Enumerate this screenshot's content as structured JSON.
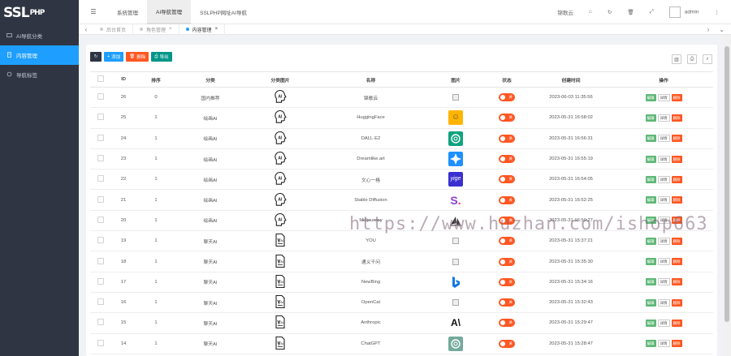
{
  "brand": {
    "logo_main": "SSL",
    "logo_sup": "PHP"
  },
  "sidebar": {
    "items": [
      {
        "label": "AI导航分类",
        "icon": "folder-icon",
        "active": false
      },
      {
        "label": "内容管理",
        "icon": "document-icon",
        "active": true
      },
      {
        "label": "导航标签",
        "icon": "tag-icon",
        "active": false
      }
    ]
  },
  "topbar": {
    "menu_icon": "☰",
    "nav": [
      {
        "label": "系统管理",
        "active": false
      },
      {
        "label": "AI导航管理",
        "active": true
      },
      {
        "label": "SSLPHP网址AI导航",
        "active": false
      }
    ],
    "link": "锦歌云",
    "user": "admin",
    "icons": [
      "home-icon",
      "refresh-icon",
      "trash-icon",
      "fullscreen-icon",
      "more-icon"
    ]
  },
  "tabs": [
    {
      "label": "后台首页",
      "active": false
    },
    {
      "label": "角色管理",
      "active": false
    },
    {
      "label": "内容管理",
      "active": true
    }
  ],
  "toolbar": {
    "add": "添加",
    "delete": "删除",
    "export": "导出"
  },
  "table": {
    "headers": [
      "ID",
      "排序",
      "分类",
      "分类图片",
      "名称",
      "图片",
      "状态",
      "创建时间",
      "操作"
    ],
    "toggle_label": "关",
    "ops": {
      "edit": "编辑",
      "detail": "详情",
      "delete": "删除"
    },
    "rows": [
      {
        "id": "26",
        "sort": "0",
        "category": "国内推荐",
        "cat_icon": "ai-head",
        "name": "锦歌云",
        "pic": "broken",
        "time": "2023-06-03 11:35:56"
      },
      {
        "id": "25",
        "sort": "1",
        "category": "绘画AI",
        "cat_icon": "ai-head",
        "name": "HuggingFace",
        "pic": "hugging",
        "time": "2023-05-31 16:58:02"
      },
      {
        "id": "24",
        "sort": "1",
        "category": "绘画AI",
        "cat_icon": "ai-head",
        "name": "DALL·E2",
        "pic": "openai",
        "time": "2023-05-31 16:56:31"
      },
      {
        "id": "23",
        "sort": "1",
        "category": "绘画AI",
        "cat_icon": "ai-head",
        "name": "Dreamlike.art",
        "pic": "dreamlike",
        "time": "2023-05-31 16:55:19"
      },
      {
        "id": "22",
        "sort": "1",
        "category": "绘画AI",
        "cat_icon": "ai-head",
        "name": "文心一格",
        "pic": "wenxin",
        "time": "2023-05-31 16:54:05"
      },
      {
        "id": "21",
        "sort": "1",
        "category": "绘画AI",
        "cat_icon": "ai-head",
        "name": "Stable Diffusion",
        "pic": "stable",
        "time": "2023-05-31 16:52:25"
      },
      {
        "id": "20",
        "sort": "1",
        "category": "绘画AI",
        "cat_icon": "ai-head",
        "name": "Midjourney",
        "pic": "midjourney",
        "time": "2023-05-31 16:50:27"
      },
      {
        "id": "19",
        "sort": "1",
        "category": "聊天AI",
        "cat_icon": "chat-doc",
        "name": "YOU",
        "pic": "broken",
        "time": "2023-05-31 15:37:21"
      },
      {
        "id": "18",
        "sort": "1",
        "category": "聊天AI",
        "cat_icon": "chat-doc",
        "name": "通义千问",
        "pic": "broken",
        "time": "2023-05-31 15:35:30"
      },
      {
        "id": "17",
        "sort": "1",
        "category": "聊天AI",
        "cat_icon": "chat-doc",
        "name": "NewBing",
        "pic": "bing",
        "time": "2023-05-31 15:34:16"
      },
      {
        "id": "16",
        "sort": "1",
        "category": "聊天AI",
        "cat_icon": "chat-doc",
        "name": "OpenCat",
        "pic": "broken",
        "time": "2023-05-31 15:32:43"
      },
      {
        "id": "15",
        "sort": "1",
        "category": "聊天AI",
        "cat_icon": "chat-doc",
        "name": "Anthropic",
        "pic": "anthropic",
        "time": "2023-05-31 15:29:47"
      },
      {
        "id": "14",
        "sort": "1",
        "category": "聊天AI",
        "cat_icon": "chat-doc",
        "name": "ChatGPT",
        "pic": "chatgpt",
        "time": "2023-05-31 15:28:47"
      }
    ]
  },
  "watermark": "https://www.huzhan.com/ishop663"
}
